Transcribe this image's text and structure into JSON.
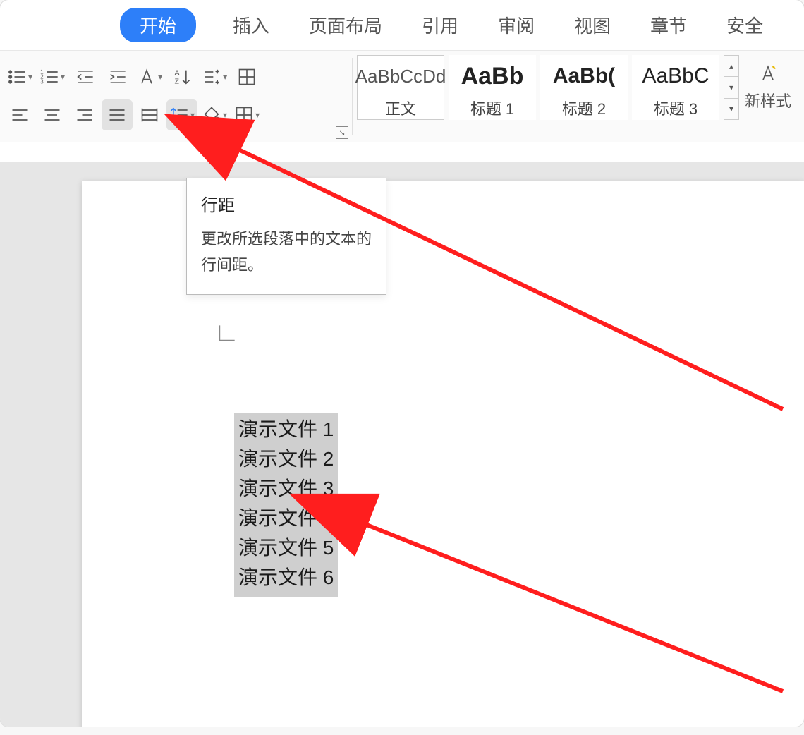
{
  "tabs": {
    "start": "开始",
    "insert": "插入",
    "layout": "页面布局",
    "ref": "引用",
    "review": "审阅",
    "view": "视图",
    "chapter": "章节",
    "secure": "安全"
  },
  "ribbon": {
    "styles": {
      "body_preview": "AaBbCcDd",
      "body_name": "正文",
      "h1_preview": "AaBb",
      "h1_name": "标题 1",
      "h2_preview": "AaBb(",
      "h2_name": "标题 2",
      "h3_preview": "AaBbC",
      "h3_name": "标题 3"
    },
    "newstyle_label": "新样式"
  },
  "tooltip": {
    "title": "行距",
    "body": "更改所选段落中的文本的行间距。"
  },
  "document": {
    "lines": [
      "演示文件 1",
      "演示文件 2",
      "演示文件 3",
      "演示文件 4",
      "演示文件 5",
      "演示文件 6"
    ]
  }
}
